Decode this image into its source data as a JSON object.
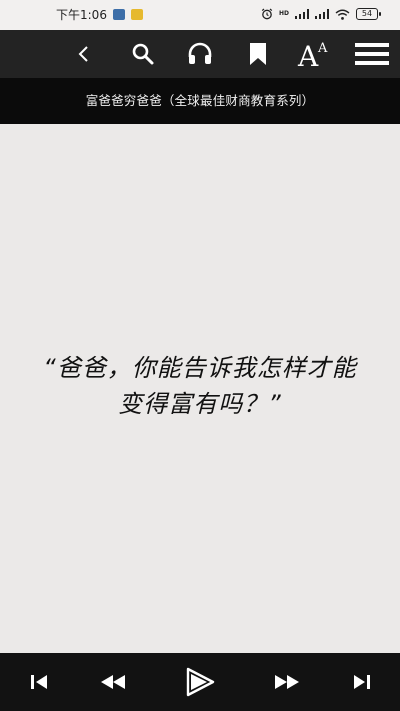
{
  "status_bar": {
    "time": "下午1:06",
    "network_badge": "HD",
    "battery_level": "54"
  },
  "toolbar": {
    "icons": [
      "back-icon",
      "search-icon",
      "headphones-icon",
      "bookmark-icon",
      "font-size-icon",
      "menu-icon"
    ]
  },
  "book": {
    "title": "富爸爸穷爸爸（全球最佳财商教育系列）"
  },
  "content": {
    "quote_line1": "“爸爸，你能告诉我怎样才能",
    "quote_line2": "变得富有吗？”"
  },
  "player": {
    "controls": [
      "skip-previous-icon",
      "rewind-icon",
      "play-icon",
      "fast-forward-icon",
      "skip-next-icon"
    ]
  },
  "colors": {
    "toolbar_bg": "#232323",
    "title_bg": "#0b0b0b",
    "page_bg": "#ebe9e8",
    "player_bg": "#121212"
  }
}
